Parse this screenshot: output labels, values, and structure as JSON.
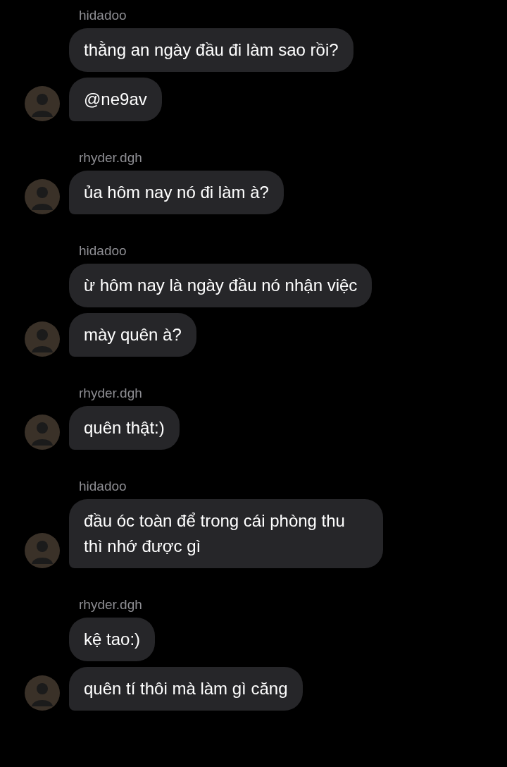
{
  "groups": [
    {
      "sender": "hidadoo",
      "messages": [
        "thằng an ngày đầu đi làm sao rồi?",
        "@ne9av"
      ]
    },
    {
      "sender": "rhyder.dgh",
      "messages": [
        "ủa hôm nay nó đi làm à?"
      ]
    },
    {
      "sender": "hidadoo",
      "messages": [
        "ừ hôm nay là ngày đầu nó nhận việc",
        "mày quên à?"
      ]
    },
    {
      "sender": "rhyder.dgh",
      "messages": [
        "quên thật:)"
      ]
    },
    {
      "sender": "hidadoo",
      "messages": [
        "đầu óc toàn để trong cái phòng thu thì nhớ được gì"
      ]
    },
    {
      "sender": "rhyder.dgh",
      "messages": [
        "kệ tao:)",
        "quên tí thôi mà làm gì căng"
      ]
    }
  ]
}
